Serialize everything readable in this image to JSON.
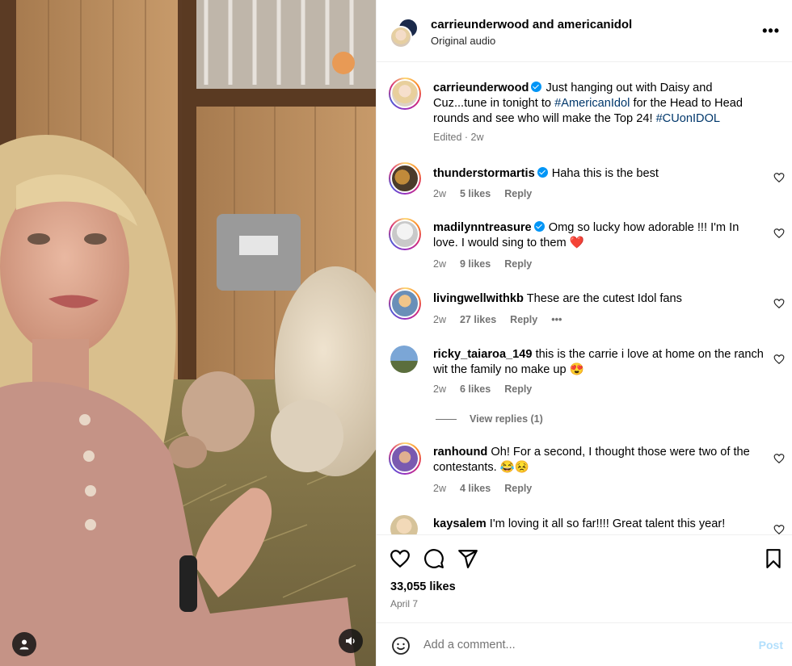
{
  "header": {
    "names": "carrieunderwood and americanidol",
    "audio": "Original audio",
    "more_icon": "more-horizontal-icon"
  },
  "caption": {
    "user": "carrieunderwood",
    "text_1": "Just hanging out with Daisy and Cuz...tune in tonight to ",
    "hashtag_1": "#AmericanIdol",
    "text_2": " for the Head to Head rounds and see who will make the Top 24! ",
    "hashtag_2": "#CUonIDOL",
    "edited": "Edited · 2w"
  },
  "comments": [
    {
      "user": "thunderstormartis",
      "verified": true,
      "text": "Haha this is the best",
      "time": "2w",
      "likes": "5 likes",
      "reply": "Reply"
    },
    {
      "user": "madilynntreasure",
      "verified": true,
      "text": "Omg so lucky how adorable !!! I'm In love. I would sing to them ❤️",
      "time": "2w",
      "likes": "9 likes",
      "reply": "Reply"
    },
    {
      "user": "livingwellwithkb",
      "verified": false,
      "text": "These are the cutest Idol fans",
      "time": "2w",
      "likes": "27 likes",
      "reply": "Reply",
      "more": "•••"
    },
    {
      "user": "ricky_taiaroa_149",
      "verified": false,
      "text": "this is the carrie i love at home on the ranch wit the family no make up 😍",
      "time": "2w",
      "likes": "6 likes",
      "reply": "Reply",
      "view_replies": "View replies (1)"
    },
    {
      "user": "ranhound",
      "verified": false,
      "text": "Oh! For a second, I thought those were two of the contestants. 😂😣",
      "time": "2w",
      "likes": "4 likes",
      "reply": "Reply"
    },
    {
      "user": "kaysalem",
      "verified": false,
      "text": "I'm loving it all so far!!!! Great talent this year!"
    }
  ],
  "actions": {
    "like_icon": "heart-icon",
    "comment_icon": "comment-icon",
    "share_icon": "share-icon",
    "save_icon": "bookmark-icon",
    "likes": "33,055 likes",
    "date": "April 7"
  },
  "add_comment": {
    "placeholder": "Add a comment...",
    "post": "Post"
  },
  "colors": {
    "link": "#00376b",
    "verified": "#0095f6",
    "post_disabled": "#b2dffc",
    "muted": "#737373"
  }
}
